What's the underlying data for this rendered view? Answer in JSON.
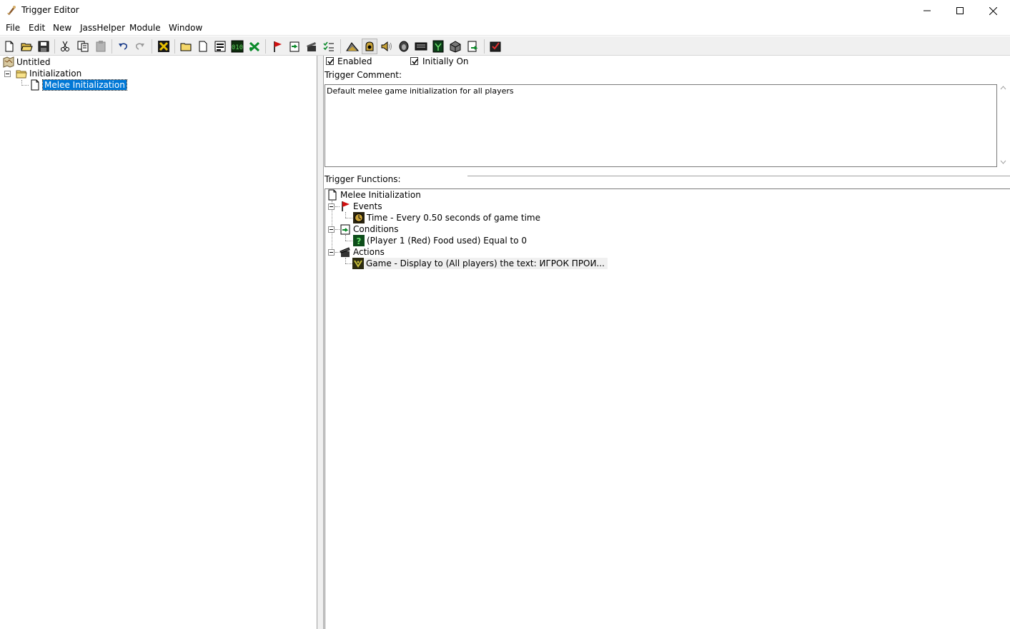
{
  "window": {
    "title": "Trigger Editor"
  },
  "menu": [
    "File",
    "Edit",
    "New",
    "JassHelper",
    "Module",
    "Window"
  ],
  "toolbar": {
    "buttons": [
      "new-map-icon",
      "open-icon",
      "save-icon",
      "cut-icon",
      "copy-icon",
      "paste-icon",
      "undo-icon",
      "redo-icon",
      "jasshelper-icon",
      "new-category-icon",
      "new-trigger-icon",
      "new-comment-icon",
      "variables-icon",
      "convert-icon",
      "new-event-icon",
      "new-condition-icon",
      "new-action-icon",
      "validate-icon",
      "terrain-editor-icon",
      "trigger-editor-icon",
      "sound-editor-icon",
      "object-editor-icon",
      "campaign-editor-icon",
      "ai-editor-icon",
      "object-manager-icon",
      "import-manager-icon",
      "test-map-icon"
    ]
  },
  "tree": {
    "root": "Untitled",
    "category": "Initialization",
    "trigger": "Melee Initialization"
  },
  "trigger": {
    "enabled_label": "Enabled",
    "enabled": true,
    "initially_on_label": "Initially On",
    "initially_on": true,
    "comment_label": "Trigger Comment:",
    "comment": "Default melee game initialization for all players",
    "functions_label": "Trigger Functions:"
  },
  "functions": {
    "name": "Melee Initialization",
    "events_label": "Events",
    "event": "Time - Every 0.50 seconds of game time",
    "conditions_label": "Conditions",
    "condition": "(Player 1 (Red) Food used) Equal to 0",
    "actions_label": "Actions",
    "action": "Game - Display to (All players) the text: ИГРОК ПРОИ..."
  },
  "colors": {
    "selection": "#0078d7",
    "toolbar_bg": "#f0f0f0"
  }
}
